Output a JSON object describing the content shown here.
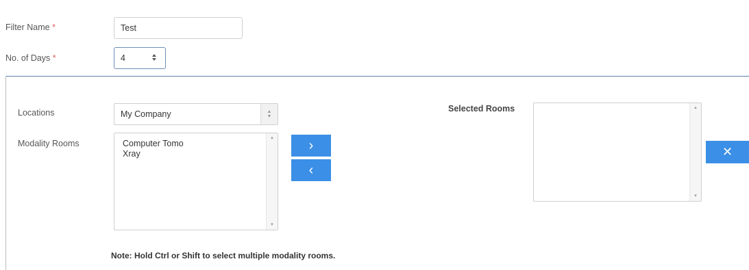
{
  "filter": {
    "name_label": "Filter Name",
    "name_value": "Test",
    "days_label": "No. of Days",
    "days_value": "4",
    "required_mark": "*"
  },
  "locations": {
    "label": "Locations",
    "selected": "My Company"
  },
  "modality": {
    "label": "Modality Rooms",
    "items": [
      "Computer Tomo",
      "Xray"
    ]
  },
  "transfer": {
    "add_symbol": "›",
    "remove_symbol": "‹"
  },
  "selected_rooms": {
    "label": "Selected Rooms",
    "items": [],
    "clear_symbol": "✕"
  },
  "note": "Note: Hold Ctrl or Shift to select multiple modality rooms.",
  "colors": {
    "accent": "#3b8fe6",
    "divider": "#5a7fa8",
    "required": "#e06060"
  }
}
